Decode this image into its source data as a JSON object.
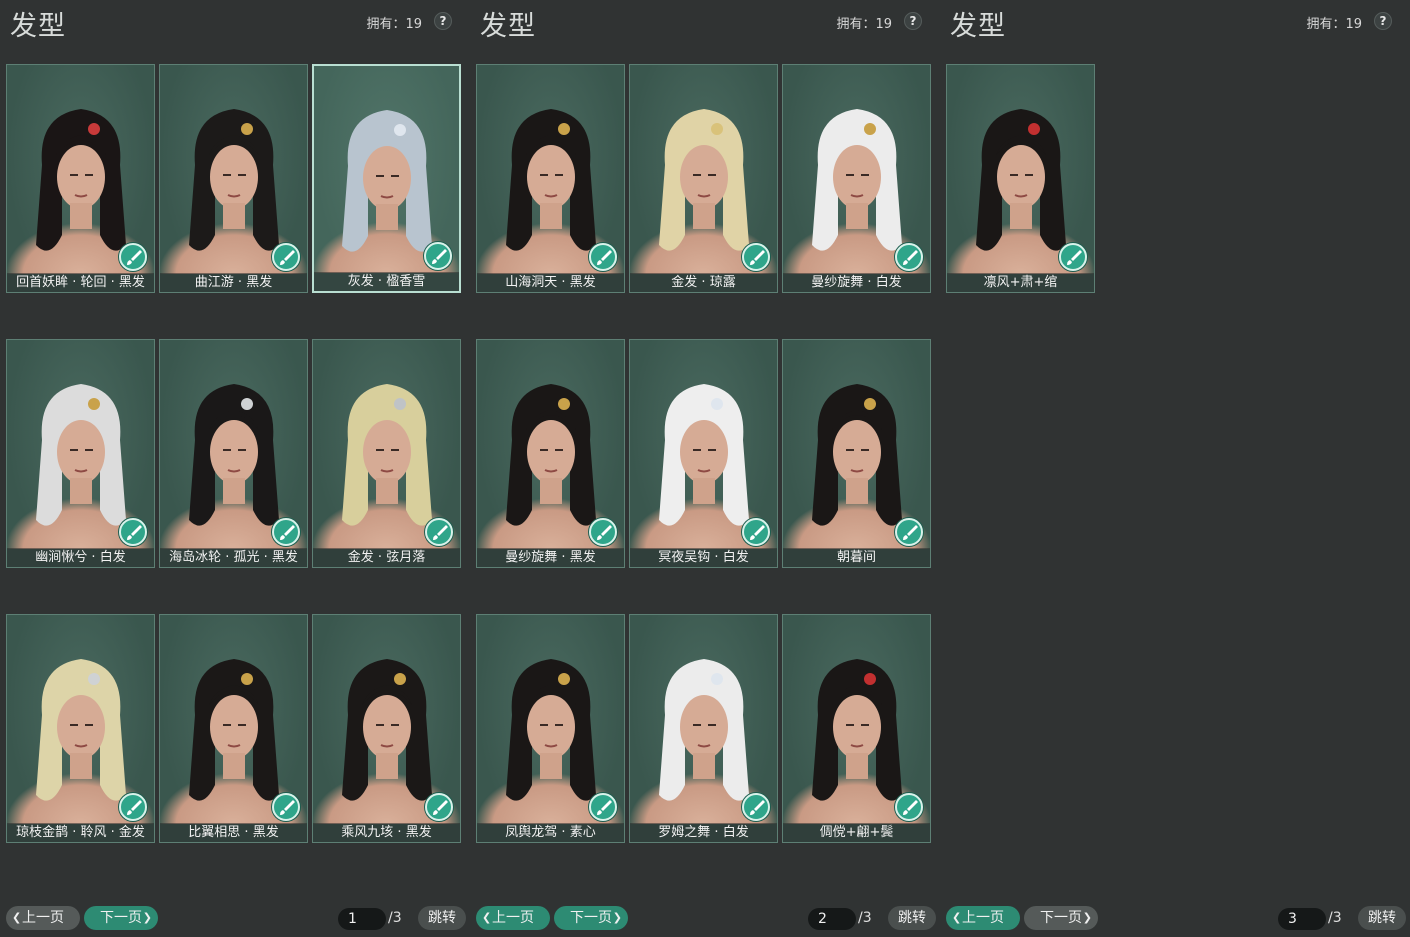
{
  "panels": [
    {
      "title": "发型",
      "owned": "拥有：19",
      "help": "?",
      "items": [
        {
          "label": "回首妖眸 · 轮回 · 黑发",
          "hair": "#1a1515",
          "accent": "#c83a3a",
          "selected": false
        },
        {
          "label": "曲江游 · 黑发",
          "hair": "#1c1a19",
          "accent": "#c9a24a",
          "selected": false
        },
        {
          "label": "灰发 · 楹香雪",
          "hair": "#b8c4cf",
          "accent": "#dfe6ee",
          "selected": true
        },
        {
          "label": "幽涧愀兮 · 白发",
          "hair": "#dcdcdc",
          "accent": "#c9a24a",
          "selected": false
        },
        {
          "label": "海岛冰轮 · 孤光 · 黑发",
          "hair": "#1a1818",
          "accent": "#cfd2d4",
          "selected": false
        },
        {
          "label": "金发 · 弦月落",
          "hair": "#d8cf9c",
          "accent": "#bfc3c7",
          "selected": false
        },
        {
          "label": "琼枝金鹊 · 聆风 · 金发",
          "hair": "#ddd4a8",
          "accent": "#cfd2d4",
          "selected": false
        },
        {
          "label": "比翼相思 · 黑发",
          "hair": "#1b1817",
          "accent": "#c9a24a",
          "selected": false
        },
        {
          "label": "乘风九垓 · 黑发",
          "hair": "#1b1817",
          "accent": "#c9a24a",
          "selected": false
        }
      ],
      "pager": {
        "prev": "上一页",
        "next": "下一页",
        "page": "1",
        "total": "/3",
        "jump": "跳转",
        "active": "next"
      }
    },
    {
      "title": "发型",
      "owned": "拥有：19",
      "help": "?",
      "items": [
        {
          "label": "山海洞天 · 黑发",
          "hair": "#1a1716",
          "accent": "#c9a24a",
          "selected": false
        },
        {
          "label": "金发 · 琼露",
          "hair": "#e0d3a6",
          "accent": "#d9c27a",
          "selected": false
        },
        {
          "label": "曼纱旋舞 · 白发",
          "hair": "#ececec",
          "accent": "#c9a24a",
          "selected": false
        },
        {
          "label": "曼纱旋舞 · 黑发",
          "hair": "#1a1716",
          "accent": "#c9a24a",
          "selected": false
        },
        {
          "label": "冥夜吴钩 · 白发",
          "hair": "#eeeeee",
          "accent": "#dfe6ee",
          "selected": false
        },
        {
          "label": "朝暮间",
          "hair": "#1a1716",
          "accent": "#c9a24a",
          "selected": false
        },
        {
          "label": "凤舆龙驾 · 素心",
          "hair": "#1a1716",
          "accent": "#c9a24a",
          "selected": false
        },
        {
          "label": "罗姆之舞 · 白发",
          "hair": "#ececec",
          "accent": "#dfe6ee",
          "selected": false
        },
        {
          "label": "倜傥+翩+鬓",
          "hair": "#1a1716",
          "accent": "#c23030",
          "selected": false
        }
      ],
      "pager": {
        "prev": "上一页",
        "next": "下一页",
        "page": "2",
        "total": "/3",
        "jump": "跳转",
        "active": "both"
      }
    },
    {
      "title": "发型",
      "owned": "拥有：19",
      "help": "?",
      "items": [
        {
          "label": "凛风+肃+绾",
          "hair": "#1a1716",
          "accent": "#c23030",
          "selected": false
        }
      ],
      "pager": {
        "prev": "上一页",
        "next": "下一页",
        "page": "3",
        "total": "/3",
        "jump": "跳转",
        "active": "prev"
      }
    }
  ],
  "colors": {
    "card_bg": "#3a574e",
    "card_border": "#5d7f74",
    "dye_button": "#2fa58a",
    "active_button": "#2d8b73",
    "panel_bg": "#303333"
  },
  "icons": {
    "dye": "paint-brush-icon",
    "help": "question-icon"
  }
}
